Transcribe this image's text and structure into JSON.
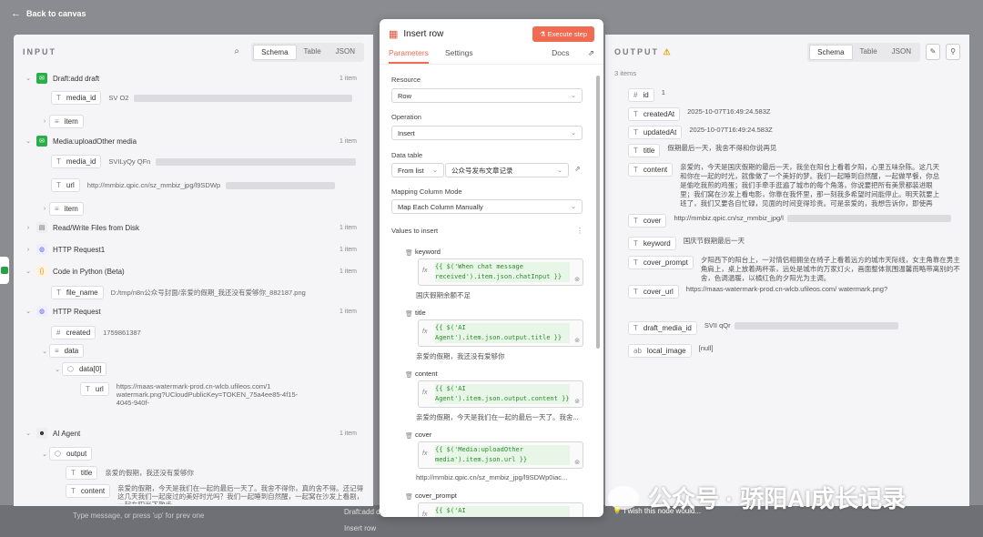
{
  "topbar": {
    "back_label": "Back to canvas"
  },
  "input": {
    "title": "INPUT",
    "views": [
      "Schema",
      "Table",
      "JSON"
    ],
    "nodes": [
      {
        "name": "Draft:add draft",
        "count": "1 item",
        "fields": [
          {
            "key": "media_id",
            "value": "SV O2"
          },
          {
            "key": "item",
            "value": ""
          }
        ]
      },
      {
        "name": "Media:uploadOther media",
        "count": "1 item",
        "fields": [
          {
            "key": "media_id",
            "value": "SVILyQy QFn"
          },
          {
            "key": "url",
            "value": "http://mmbiz.qpic.cn/sz_mmbiz_jpg/l9SDWp"
          },
          {
            "key": "item",
            "value": ""
          }
        ]
      },
      {
        "name": "Read/Write Files from Disk",
        "count": "1 item"
      },
      {
        "name": "HTTP Request1",
        "count": "1 item"
      },
      {
        "name": "Code in Python (Beta)",
        "count": "1 item",
        "fields": [
          {
            "key": "file_name",
            "value": "D:/tmp/n8n公众号封面/亲爱的假期_我还没有爱够你_882187.png"
          }
        ]
      },
      {
        "name": "HTTP Request",
        "count": "1 item",
        "fields": [
          {
            "key": "created",
            "value": "1759861387"
          },
          {
            "key": "data",
            "value": ""
          },
          {
            "key": "data[0]",
            "value": ""
          },
          {
            "key": "url",
            "value": "https://maas-watermark-prod.cn-wlcb.ufileos.com/1 watermark.png?UCloudPublicKey=TOKEN_75a4ee85-4f15-4045-940f-"
          }
        ]
      },
      {
        "name": "AI Agent",
        "count": "1 item",
        "fields": [
          {
            "key": "output",
            "value": ""
          },
          {
            "key": "title",
            "value": "亲爱的假期，我还没有爱够你"
          },
          {
            "key": "content",
            "value": "亲爱的假期，今天是我们在一起的最后一天了。我舍不得你，真的舍不得。还记得这几天我们一起度过的美好时光吗？我们一起睡到自然醒，一起窝在沙发上看剧，一起在阳光下散步……"
          }
        ]
      }
    ]
  },
  "dialog": {
    "title": "Insert row",
    "execute_label": "Execute step",
    "tabs": [
      "Parameters",
      "Settings"
    ],
    "docs_label": "Docs",
    "resource_label": "Resource",
    "resource_value": "Row",
    "operation_label": "Operation",
    "operation_value": "Insert",
    "datatable_label": "Data table",
    "datatable_mode": "From list",
    "datatable_value": "公众号发布文章记录",
    "mapping_label": "Mapping Column Mode",
    "mapping_value": "Map Each Column Manually",
    "values_label": "Values to insert",
    "values": [
      {
        "name": "keyword",
        "expr": "{{ $('When chat message received').item.json.chatInput }}",
        "result": "国庆假期余额不足"
      },
      {
        "name": "title",
        "expr": "{{ $('AI Agent').item.json.output.title }}",
        "result": "亲爱的假期，我还没有爱够你"
      },
      {
        "name": "content",
        "expr": "{{ $('AI Agent').item.json.output.content }}",
        "result": "亲爱的假期，今天是我们在一起的最后一天了。我舍..."
      },
      {
        "name": "cover",
        "expr": "{{ $('Media:uploadOther media').item.json.url }}",
        "result": "http://mmbiz.qpic.cn/sz_mmbiz_jpg/l9SDWp0iac..."
      },
      {
        "name": "cover_prompt",
        "expr": "{{ $('AI Agent').item.json.output.co",
        "result": ""
      }
    ],
    "feedback_label": "I wish this node would..."
  },
  "output": {
    "title": "OUTPUT",
    "views": [
      "Schema",
      "Table",
      "JSON"
    ],
    "items_count": "3 items",
    "fields": [
      {
        "key": "id",
        "value": "1"
      },
      {
        "key": "createdAt",
        "value": "2025-10-07T16:49:24.583Z"
      },
      {
        "key": "updatedAt",
        "value": "2025-10-07T16:49:24.583Z"
      },
      {
        "key": "title",
        "value": "假期最后一天，我舍不得和你说再见"
      },
      {
        "key": "content",
        "value": "亲爱的，今天是国庆假期的最后一天，我坐在阳台上看着夕阳，心里五味杂陈。这几天和你在一起的时光，就像做了一个美好的梦。我们一起睡到自然醒，一起做早餐，你总是偷吃我煎的鸡蛋；我们手牵手逛遍了城市的每个角落，你说要把所有美景都装进眼里；我们窝在沙发上看电影，你靠在我怀里，那一刻我多希望时间能停止。明天就要上班了，我们又要各自忙碌，见面的时间变得珍贵。可是亲爱的，我想告诉你，即使再忙，我也会想你，会想起这个假期里你的每一个笑容。假期会结束，但我对你的爱永远不会结束。"
      },
      {
        "key": "cover",
        "value": "http://mmbiz.qpic.cn/sz_mmbiz_jpg/l"
      },
      {
        "key": "keyword",
        "value": "国庆节假期最后一天"
      },
      {
        "key": "cover_prompt",
        "value": "夕阳西下的阳台上，一对情侣相拥坐在椅子上看着远方的城市天际线，女主角靠在男主角肩上，桌上放着两杯茶，远处是城市的万家灯火，画面整体氛围温馨而略带离别的不舍，色调温暖，以橘红色的夕阳光为主调。"
      },
      {
        "key": "cover_url",
        "value": "https://maas-watermark-prod.cn-wlcb.ufileos.com/ watermark.png?"
      },
      {
        "key": "draft_media_id",
        "value": "SVII qQr"
      },
      {
        "key": "local_image",
        "value": "[null]"
      }
    ]
  },
  "bottom": {
    "chat_placeholder": "Type message, or press 'up' for prev one",
    "item1": "Draft:add d...",
    "item2": "Insert row"
  },
  "watermark": "公众号 · 骄阳AI成长记录"
}
